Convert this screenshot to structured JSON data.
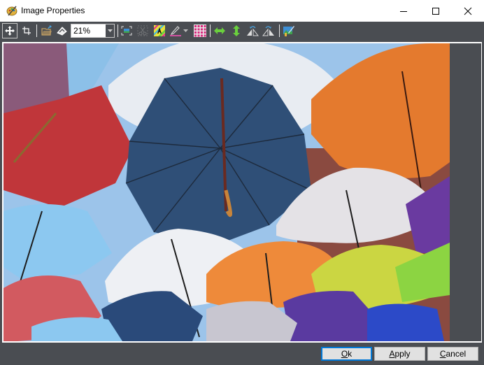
{
  "window": {
    "title": "Image Properties",
    "app_icon": "paint-palette-icon",
    "controls": [
      {
        "name": "minimize",
        "icon": "minimize-icon"
      },
      {
        "name": "maximize",
        "icon": "maximize-icon"
      },
      {
        "name": "close",
        "icon": "close-icon"
      }
    ]
  },
  "toolbar": {
    "items": [
      {
        "name": "move-tool",
        "icon": "move-arrows-icon",
        "active": true
      },
      {
        "name": "crop-tool",
        "icon": "crop-icon"
      },
      {
        "name": "open-image",
        "icon": "folder-open-icon"
      },
      {
        "name": "scan",
        "icon": "scanner-icon"
      },
      {
        "name": "fit-to-window",
        "icon": "fit-image-icon"
      },
      {
        "name": "cut-selection",
        "icon": "scissors-icon",
        "disabled": true
      },
      {
        "name": "transparency",
        "icon": "color-transparency-icon"
      },
      {
        "name": "draw",
        "icon": "pen-icon"
      },
      {
        "name": "pattern",
        "icon": "pattern-grid-icon"
      },
      {
        "name": "flip-horizontal",
        "icon": "flip-horizontal-icon"
      },
      {
        "name": "flip-vertical",
        "icon": "flip-vertical-icon"
      },
      {
        "name": "rotate-left",
        "icon": "rotate-left-icon"
      },
      {
        "name": "rotate-right",
        "icon": "rotate-right-icon"
      },
      {
        "name": "image-effects",
        "icon": "image-edit-icon"
      }
    ],
    "zoom": {
      "value": "21%"
    }
  },
  "canvas": {
    "image_description": "Colorful umbrellas suspended against a blue sky"
  },
  "buttons": {
    "ok": {
      "mnemonic": "O",
      "rest": "k"
    },
    "apply": {
      "mnemonic": "A",
      "rest": "pply"
    },
    "cancel": {
      "mnemonic": "C",
      "rest": "ancel"
    }
  },
  "colors": {
    "toolbar_bg": "#4a4d52",
    "accent": "#0078d7"
  }
}
